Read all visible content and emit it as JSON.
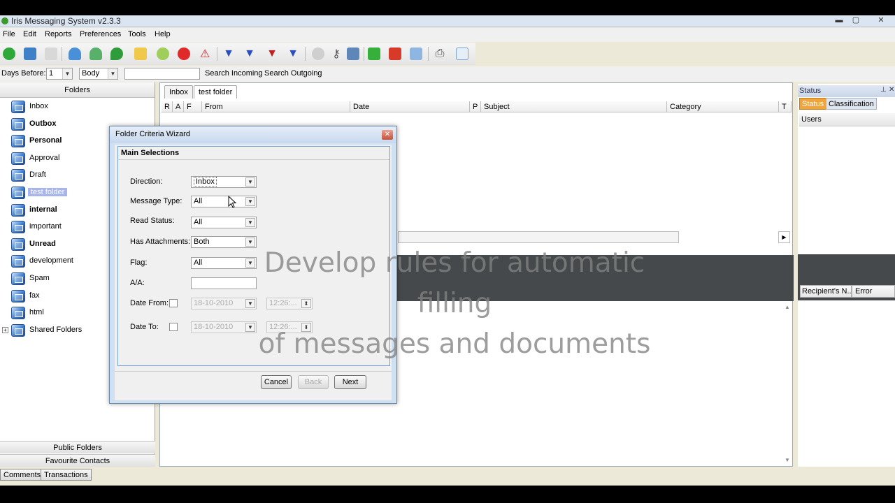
{
  "window": {
    "title": "Iris Messaging System v2.3.3"
  },
  "menu": [
    "File",
    "Edit",
    "Reports",
    "Preferences",
    "Tools",
    "Help"
  ],
  "toolbar": {
    "icons": [
      "new-icon",
      "import-icon",
      "edit-icon",
      "user-icon",
      "users-icon",
      "forward-icon",
      "mail-icon",
      "clock-icon",
      "stop-icon",
      "warning-icon",
      "filter-icon",
      "filter-down-icon",
      "filter-x-icon",
      "filter-reset-icon",
      "timer-icon",
      "key-icon",
      "inbox-icon",
      "folder-green-icon",
      "folder-red-icon",
      "sync-icon",
      "print-icon",
      "export-icon"
    ]
  },
  "search": {
    "days_before_label": "Days Before:",
    "days_value": "1",
    "field_value": "Body",
    "incoming_label": "Search Incoming",
    "outgoing_label": "Search Outgoing"
  },
  "folders": {
    "header": "Folders",
    "items": [
      {
        "label": "Inbox",
        "bold": false
      },
      {
        "label": "Outbox",
        "bold": true
      },
      {
        "label": "Personal",
        "bold": true
      },
      {
        "label": "Approval",
        "bold": false
      },
      {
        "label": "Draft",
        "bold": false
      },
      {
        "label": "test folder",
        "bold": false,
        "selected": true
      },
      {
        "label": "internal",
        "bold": true
      },
      {
        "label": "important",
        "bold": false
      },
      {
        "label": "Unread",
        "bold": true
      },
      {
        "label": "development",
        "bold": false
      },
      {
        "label": "Spam",
        "bold": false
      },
      {
        "label": "fax",
        "bold": false
      },
      {
        "label": "html",
        "bold": false
      },
      {
        "label": "Shared Folders",
        "bold": false
      }
    ],
    "public_folders": "Public Folders",
    "favourite_contacts": "Favourite Contacts"
  },
  "main": {
    "tabs": [
      "Inbox",
      "test folder"
    ],
    "columns": [
      "R",
      "A",
      "F",
      "From",
      "Date",
      "P",
      "Subject",
      "Category",
      "T"
    ]
  },
  "right": {
    "title": "Status",
    "tabs": [
      "Status",
      "Classification"
    ],
    "users_label": "Users",
    "recipient_col": "Recipient's N...",
    "error_col": "Error"
  },
  "bottom": {
    "comments": "Comments",
    "transactions": "Transactions"
  },
  "dialog": {
    "title": "Folder Criteria Wizard",
    "section": "Main Selections",
    "direction_label": "Direction:",
    "direction_value": "Inbox",
    "message_type_label": "Message Type:",
    "message_type_value": "All",
    "read_status_label": "Read Status:",
    "read_status_value": "All",
    "has_attachments_label": "Has Attachments:",
    "has_attachments_value": "Both",
    "flag_label": "Flag:",
    "flag_value": "All",
    "aa_label": "A/A:",
    "date_from_label": "Date From:",
    "date_from_value": "18-10-2010",
    "time_from_value": "12:26:...",
    "date_to_label": "Date To:",
    "date_to_value": "18-10-2010",
    "time_to_value": "12:26:...",
    "cancel": "Cancel",
    "back": "Back",
    "next": "Next"
  },
  "overlay": {
    "line1": "Develop rules for automatic filling",
    "line2": "of messages and documents"
  }
}
